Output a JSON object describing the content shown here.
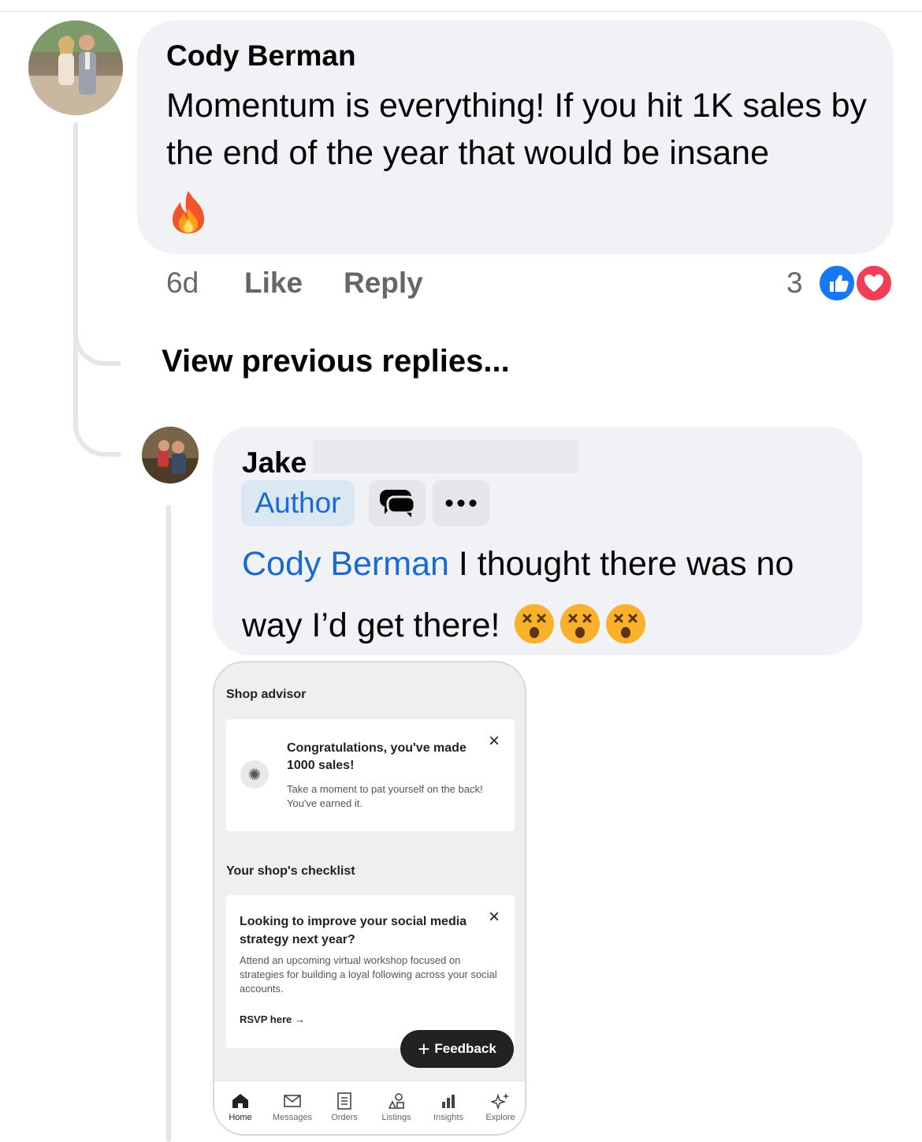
{
  "comment": {
    "author": "Cody Berman",
    "text": "Momentum is everything! If you hit 1K sales by the end of the year that would be insane",
    "emoji": "fire-emoji",
    "time": "6d",
    "like_label": "Like",
    "reply_label": "Reply",
    "reaction_count": "3",
    "reactions": [
      "like",
      "love"
    ]
  },
  "view_previous_label": "View previous replies...",
  "reply": {
    "author_first": "Jake",
    "badge": "Author",
    "mention": "Cody Berman",
    "text_part1": " I thought there was no",
    "text_part2": "way I’d get there!",
    "emojis": [
      "dizzy-face-emoji",
      "dizzy-face-emoji",
      "dizzy-face-emoji"
    ]
  },
  "screenshot": {
    "section_title": "Shop advisor",
    "card1": {
      "title": "Congratulations, you've made 1000 sales!",
      "body": "Take a moment to pat yourself on the back! You've earned it."
    },
    "checklist_title": "Your shop's checklist",
    "card2": {
      "title": "Looking to improve your social media strategy next year?",
      "body": "Attend an upcoming virtual workshop focused on strategies for building a loyal following across your social accounts.",
      "link": "RSVP here →"
    },
    "feedback_label": "Feedback",
    "tabs": [
      "Home",
      "Messages",
      "Orders",
      "Listings",
      "Insights",
      "Explore"
    ]
  },
  "colors": {
    "bubble": "#f0f2f5",
    "link_blue": "#1b6ad2",
    "like_blue": "#1877f2",
    "love_red": "#f33e58",
    "muted_text": "#65676b"
  }
}
